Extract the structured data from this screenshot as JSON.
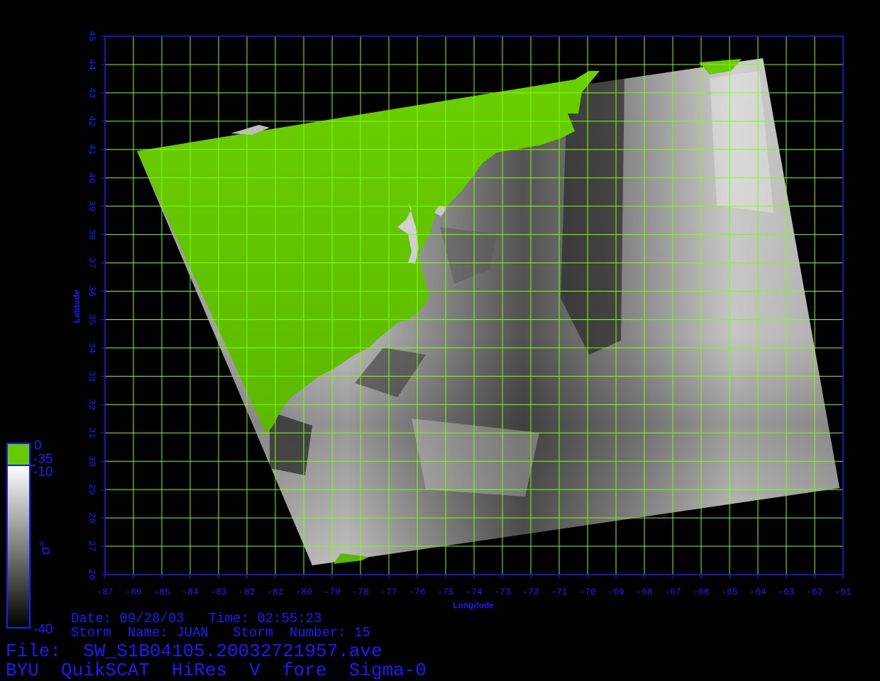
{
  "map": {
    "x_label": "Longitude",
    "y_label": "Latitude",
    "lon_range": [
      -87,
      -61
    ],
    "lat_range": [
      26,
      45
    ],
    "lon_ticks": [
      "-87",
      "-86",
      "-85",
      "-84",
      "-83",
      "-82",
      "-81",
      "-80",
      "-79",
      "-78",
      "-77",
      "-76",
      "-75",
      "-74",
      "-73",
      "-72",
      "-71",
      "-70",
      "-69",
      "-68",
      "-67",
      "-66",
      "-65",
      "-64",
      "-63",
      "-62",
      "-61"
    ],
    "lat_ticks": [
      "26",
      "27",
      "28",
      "29",
      "30",
      "31",
      "32",
      "33",
      "34",
      "35",
      "36",
      "37",
      "38",
      "39",
      "40",
      "41",
      "42",
      "43",
      "44",
      "45"
    ],
    "grid_color": "#7fff00",
    "frame_color": "#1a1aff",
    "land_color": "#66cc00"
  },
  "colorbar": {
    "top_label": "0",
    "land_label": "-35",
    "upper_label": "-10",
    "symbol": "σ°",
    "bottom_label": "-40"
  },
  "info": {
    "date_line": "Date: 09/28/03   Time: 02:55:23",
    "storm_line": "Storm  Name: JUAN   Storm  Number: 15",
    "file_line": "File:  SW_S1B04105.20032721957.ave",
    "title_line": "BYU  QuikSCAT  HiRes  V  fore  Sigma-0"
  }
}
